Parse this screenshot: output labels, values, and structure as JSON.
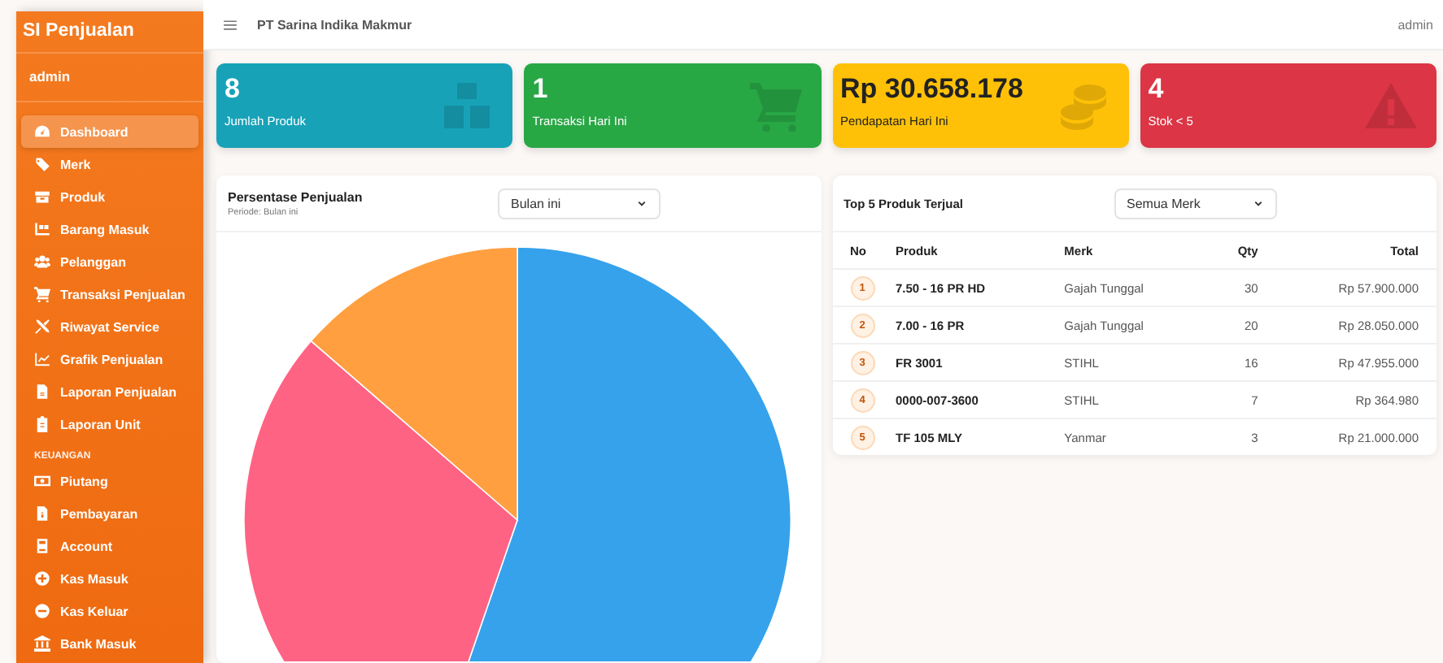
{
  "sidebar": {
    "title": "SI Penjualan",
    "user": "admin",
    "items": [
      {
        "kind": "link",
        "label": "Dashboard",
        "selected": true
      },
      {
        "kind": "link",
        "label": "Merk",
        "selected": false
      },
      {
        "kind": "link",
        "label": "Produk",
        "selected": false
      },
      {
        "kind": "link",
        "label": "Barang Masuk",
        "selected": false
      },
      {
        "kind": "link",
        "label": "Pelanggan",
        "selected": false
      },
      {
        "kind": "link",
        "label": "Transaksi Penjualan",
        "selected": false
      },
      {
        "kind": "link",
        "label": "Riwayat Service",
        "selected": false
      },
      {
        "kind": "link",
        "label": "Grafik Penjualan",
        "selected": false
      },
      {
        "kind": "link",
        "label": "Laporan Penjualan",
        "selected": false
      },
      {
        "kind": "link",
        "label": "Laporan Unit",
        "selected": false
      },
      {
        "kind": "heading",
        "label": "KEUANGAN"
      },
      {
        "kind": "link",
        "label": "Piutang",
        "selected": false
      },
      {
        "kind": "link",
        "label": "Pembayaran",
        "selected": false
      },
      {
        "kind": "link",
        "label": "Account",
        "selected": false
      },
      {
        "kind": "link",
        "label": "Kas Masuk",
        "selected": false
      },
      {
        "kind": "link",
        "label": "Kas Keluar",
        "selected": false
      },
      {
        "kind": "link",
        "label": "Bank Masuk",
        "selected": false
      }
    ]
  },
  "topbar": {
    "company": "PT Sarina Indika Makmur",
    "user": "admin"
  },
  "stat_cards": [
    {
      "value": "8",
      "label": "Jumlah Produk",
      "color": "#17a2b8"
    },
    {
      "value": "1",
      "label": "Transaksi Hari Ini",
      "color": "#28a745"
    },
    {
      "value": "Rp 30.658.178",
      "label": "Pendapatan Hari Ini",
      "color": "#ffc107"
    },
    {
      "value": "4",
      "label": "Stok < 5",
      "color": "#dc3545"
    }
  ],
  "sales_chart": {
    "title": "Persentase Penjualan",
    "subtitle": "Periode: Bulan ini",
    "period": "Bulan ini"
  },
  "top_products": {
    "title": "Top 5 Produk Terjual",
    "brand_filter": "Semua Merk",
    "columns": [
      "No",
      "Produk",
      "Merk",
      "Qty",
      "Total"
    ],
    "rows": [
      {
        "no": "1",
        "product": "7.50 - 16 PR HD",
        "brand": "Gajah Tunggal",
        "qty": "30",
        "total": "Rp 57.900.000"
      },
      {
        "no": "2",
        "product": "7.00 - 16 PR",
        "brand": "Gajah Tunggal",
        "qty": "20",
        "total": "Rp 28.050.000"
      },
      {
        "no": "3",
        "product": "FR 3001",
        "brand": "STIHL",
        "qty": "16",
        "total": "Rp 47.955.000"
      },
      {
        "no": "4",
        "product": "0000-007-3600",
        "brand": "STIHL",
        "qty": "7",
        "total": "Rp 364.980"
      },
      {
        "no": "5",
        "product": "TF 105 MLY",
        "brand": "Yanmar",
        "qty": "3",
        "total": "Rp 21.000.000"
      }
    ]
  }
}
